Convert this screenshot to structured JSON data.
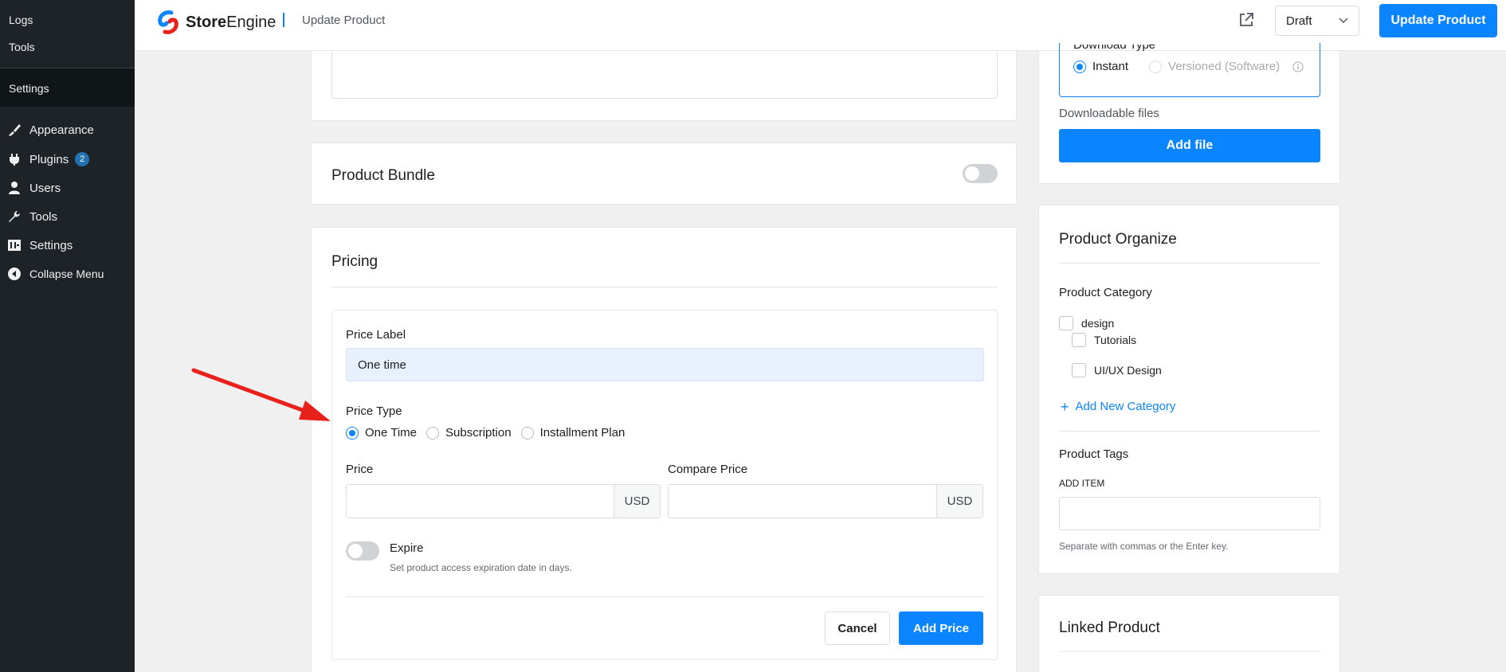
{
  "sidebar": {
    "submenu": [
      "Logs",
      "Tools"
    ],
    "settings_sub": "Settings",
    "items": [
      {
        "label": "Appearance",
        "icon": "paintbrush-icon"
      },
      {
        "label": "Plugins",
        "icon": "plugin-icon",
        "badge": "2"
      },
      {
        "label": "Users",
        "icon": "user-icon"
      },
      {
        "label": "Tools",
        "icon": "wrench-icon"
      },
      {
        "label": "Settings",
        "icon": "settings-icon"
      },
      {
        "label": "Collapse Menu",
        "icon": "collapse-icon"
      }
    ]
  },
  "header": {
    "logo_bold": "Store",
    "logo_light": "Engine",
    "breadcrumb": "Update Product",
    "status": "Draft",
    "update_label": "Update Product"
  },
  "bundle": {
    "title": "Product Bundle"
  },
  "pricing": {
    "title": "Pricing",
    "price_label_title": "Price Label",
    "price_label_value": "One time",
    "price_type_title": "Price Type",
    "price_types": [
      "One Time",
      "Subscription",
      "Installment Plan"
    ],
    "price_title": "Price",
    "compare_title": "Compare Price",
    "currency": "USD",
    "expire_title": "Expire",
    "expire_help": "Set product access expiration date in days.",
    "cancel": "Cancel",
    "add_price": "Add Price"
  },
  "download": {
    "type_title": "Download Type",
    "instant": "Instant",
    "versioned": "Versioned (Software)",
    "files_title": "Downloadable files",
    "add_file": "Add file"
  },
  "organize": {
    "title": "Product Organize",
    "category_title": "Product Category",
    "categories": [
      "design",
      "Tutorials",
      "UI/UX Design"
    ],
    "add_category": "Add New Category",
    "tags_title": "Product Tags",
    "add_item": "ADD ITEM",
    "tags_help": "Separate with commas or the Enter key."
  },
  "linked": {
    "title": "Linked Product"
  },
  "colors": {
    "accent": "#0a84ff",
    "sidebar": "#1d2327",
    "arrow": "#e8211d"
  }
}
